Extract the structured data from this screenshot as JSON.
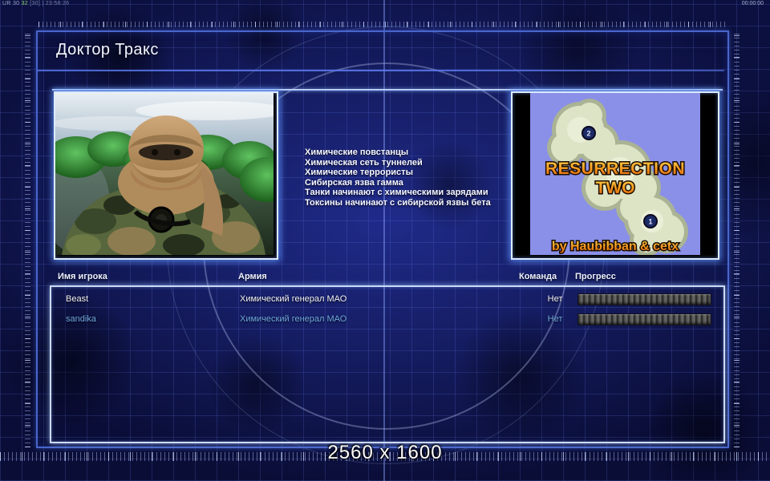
{
  "topbar": {
    "stats_left": "UR 30",
    "stats_fps": "32",
    "stats_right": "[30] | 23:58:26",
    "timer": "00:00:00"
  },
  "panel": {
    "title": "Доктор Тракс"
  },
  "abilities": [
    "Химические повстанцы",
    "Химическая сеть туннелей",
    "Химические террористы",
    "Сибирская язва гамма",
    "Танки начинают с химическими зарядами",
    "Токсины начинают с сибирской язвы бета"
  ],
  "map": {
    "name_line1": "RESURRECTION",
    "name_line2": "TWO",
    "credit": "by Haubibban & cetx",
    "marker_top": "2",
    "marker_bottom": "1"
  },
  "players": {
    "headers": {
      "name": "Имя игрока",
      "army": "Армия",
      "team": "Команда",
      "progress": "Прогресс"
    },
    "rows": [
      {
        "name": "Beast",
        "army": "Химический генерал МАО",
        "team": "Нет",
        "color": "#f2f2f2"
      },
      {
        "name": "sandika",
        "army": "Химический генерал МАО",
        "team": "Нет",
        "color": "#6fa8dc"
      }
    ]
  },
  "footer": {
    "resolution": "2560 x 1600"
  },
  "colors": {
    "panel_border": "#4a66cc",
    "box_glow": "#9fc6ff",
    "stats_green": "#8ed06a",
    "map_title_orange": "#f5941e",
    "map_sea": "#8a8fe8",
    "map_land": "#dde4c6",
    "progress_segment": "#5e5e5e",
    "background": "#0c1040"
  }
}
